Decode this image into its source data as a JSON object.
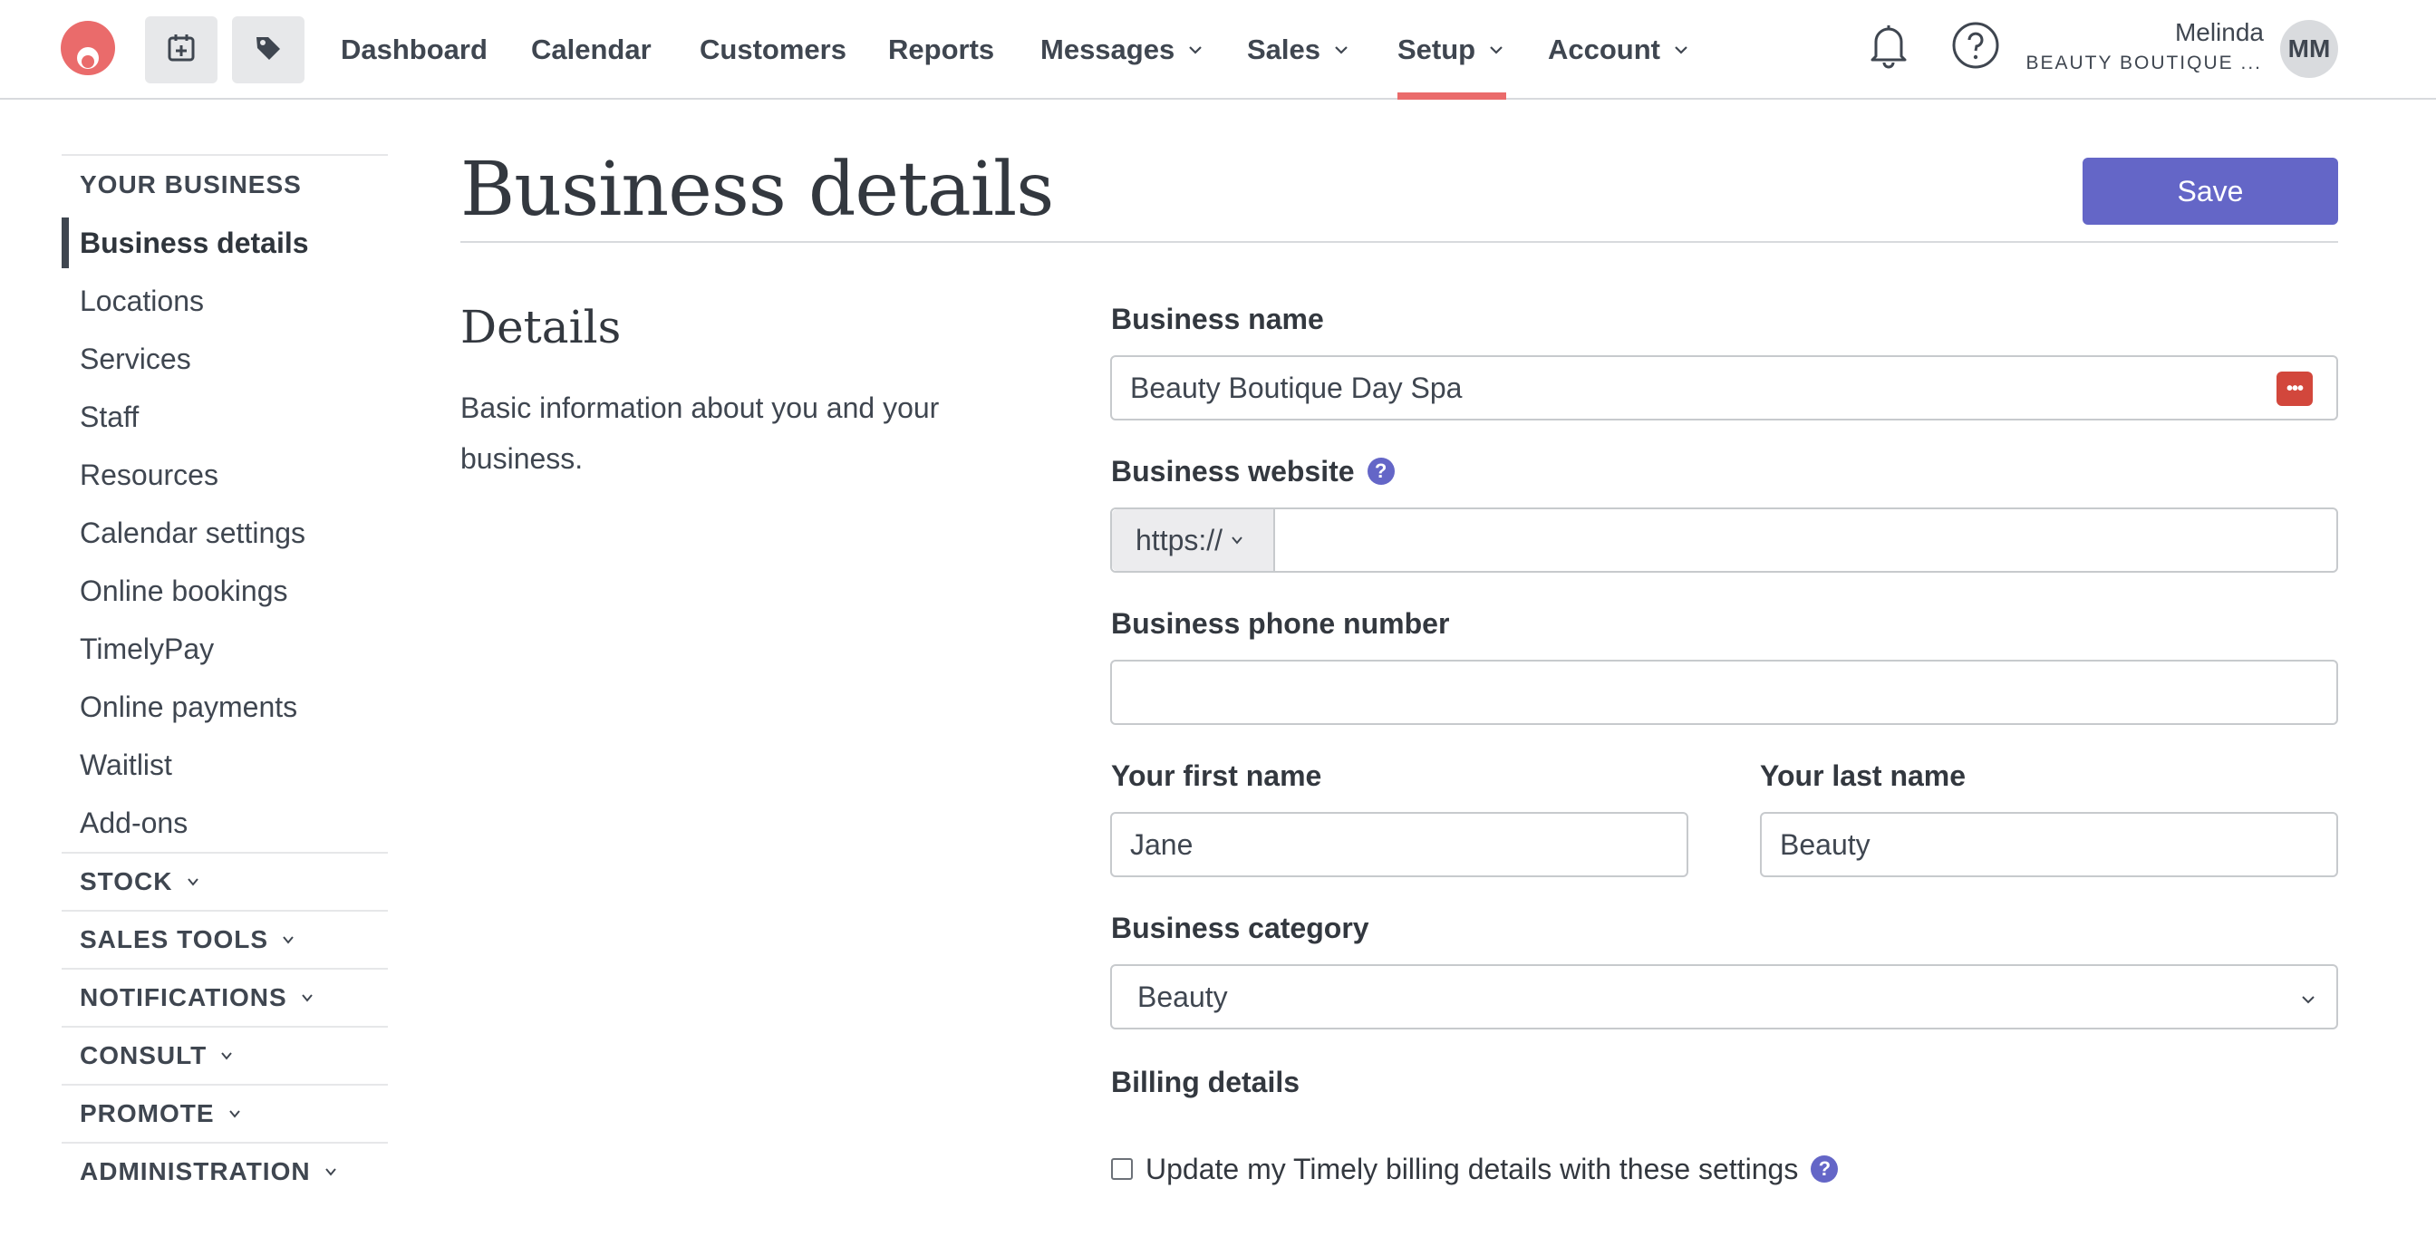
{
  "nav": {
    "items": [
      "Dashboard",
      "Calendar",
      "Customers",
      "Reports",
      "Messages",
      "Sales",
      "Setup",
      "Account"
    ],
    "active": "Setup",
    "user_name": "Melinda",
    "business_short": "BEAUTY BOUTIQUE ...",
    "avatar_initials": "MM"
  },
  "sidebar": {
    "heading": "YOUR BUSINESS",
    "items": [
      "Business details",
      "Locations",
      "Services",
      "Staff",
      "Resources",
      "Calendar settings",
      "Online bookings",
      "TimelyPay",
      "Online payments",
      "Waitlist",
      "Add-ons"
    ],
    "active": "Business details",
    "groups": [
      "STOCK",
      "SALES TOOLS",
      "NOTIFICATIONS",
      "CONSULT",
      "PROMOTE",
      "ADMINISTRATION"
    ]
  },
  "page": {
    "title": "Business details",
    "save_label": "Save",
    "section_title": "Details",
    "section_desc": "Basic information about you and your business."
  },
  "form": {
    "business_name_label": "Business name",
    "business_name_value": "Beauty Boutique Day Spa",
    "website_label": "Business website",
    "website_prefix": "https://",
    "website_value": "",
    "phone_label": "Business phone number",
    "phone_value": "",
    "first_name_label": "Your first name",
    "first_name_value": "Jane",
    "last_name_label": "Your last name",
    "last_name_value": "Beauty",
    "category_label": "Business category",
    "category_value": "Beauty",
    "billing_label": "Billing details",
    "billing_checkbox_label": "Update my Timely billing details with these settings",
    "help_glyph": "?",
    "password_manager_glyph": "•••"
  },
  "colors": {
    "brand": "#ea6b6b",
    "accent": "#6466c7",
    "password_icon": "#d2473c"
  },
  "icons": [
    "timely-logo-icon",
    "calendar-add-icon",
    "tag-icon",
    "bell-icon",
    "help-circle-icon",
    "chevron-down-icon",
    "password-manager-icon"
  ]
}
